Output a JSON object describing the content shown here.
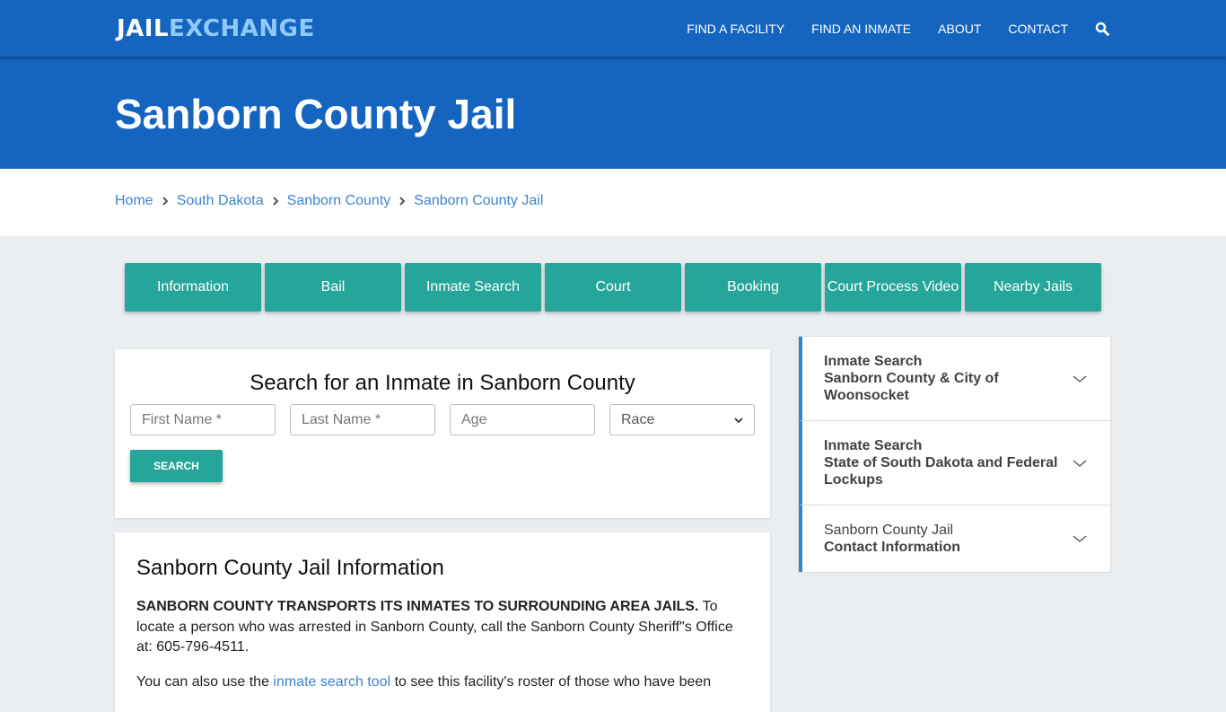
{
  "header": {
    "logo_part1": "JAIL",
    "logo_part2": "EXCHANGE",
    "nav": [
      "FIND A FACILITY",
      "FIND AN INMATE",
      "ABOUT",
      "CONTACT"
    ],
    "search_icon": "search-icon"
  },
  "hero": {
    "title": "Sanborn County Jail"
  },
  "breadcrumb": [
    "Home",
    "South Dakota",
    "Sanborn County",
    "Sanborn County Jail"
  ],
  "tabs": [
    "Information",
    "Bail",
    "Inmate Search",
    "Court",
    "Booking",
    "Court Process Video",
    "Nearby Jails"
  ],
  "search": {
    "title": "Search for an Inmate in Sanborn County",
    "first_name_placeholder": "First Name *",
    "last_name_placeholder": "Last Name *",
    "age_placeholder": "Age",
    "race_selected": "Race",
    "button": "SEARCH"
  },
  "info": {
    "title": "Sanborn County Jail Information",
    "p1_bold": "SANBORN COUNTY TRANSPORTS ITS INMATES TO SURROUNDING AREA JAILS.",
    "p1_rest": " To locate a person who was arrested in Sanborn County, call the Sanborn County Sheriff\"s Office at: 605-796-4511.",
    "p2_before": "You can also use the ",
    "p2_link": "inmate search tool",
    "p2_after": " to see this facility's roster of those who have been"
  },
  "sidebar": {
    "items": [
      {
        "line1": "Inmate Search",
        "line2": "Sanborn County & City of Woonsocket"
      },
      {
        "line1": "Inmate Search",
        "line2": "State of South Dakota and Federal Lockups"
      },
      {
        "line1": "Sanborn County Jail",
        "line2": "Contact Information"
      }
    ]
  },
  "colors": {
    "primary_blue": "#1565c0",
    "teal": "#26a69a",
    "link_blue": "#3a86d0",
    "logo_accent": "#90caf9"
  }
}
